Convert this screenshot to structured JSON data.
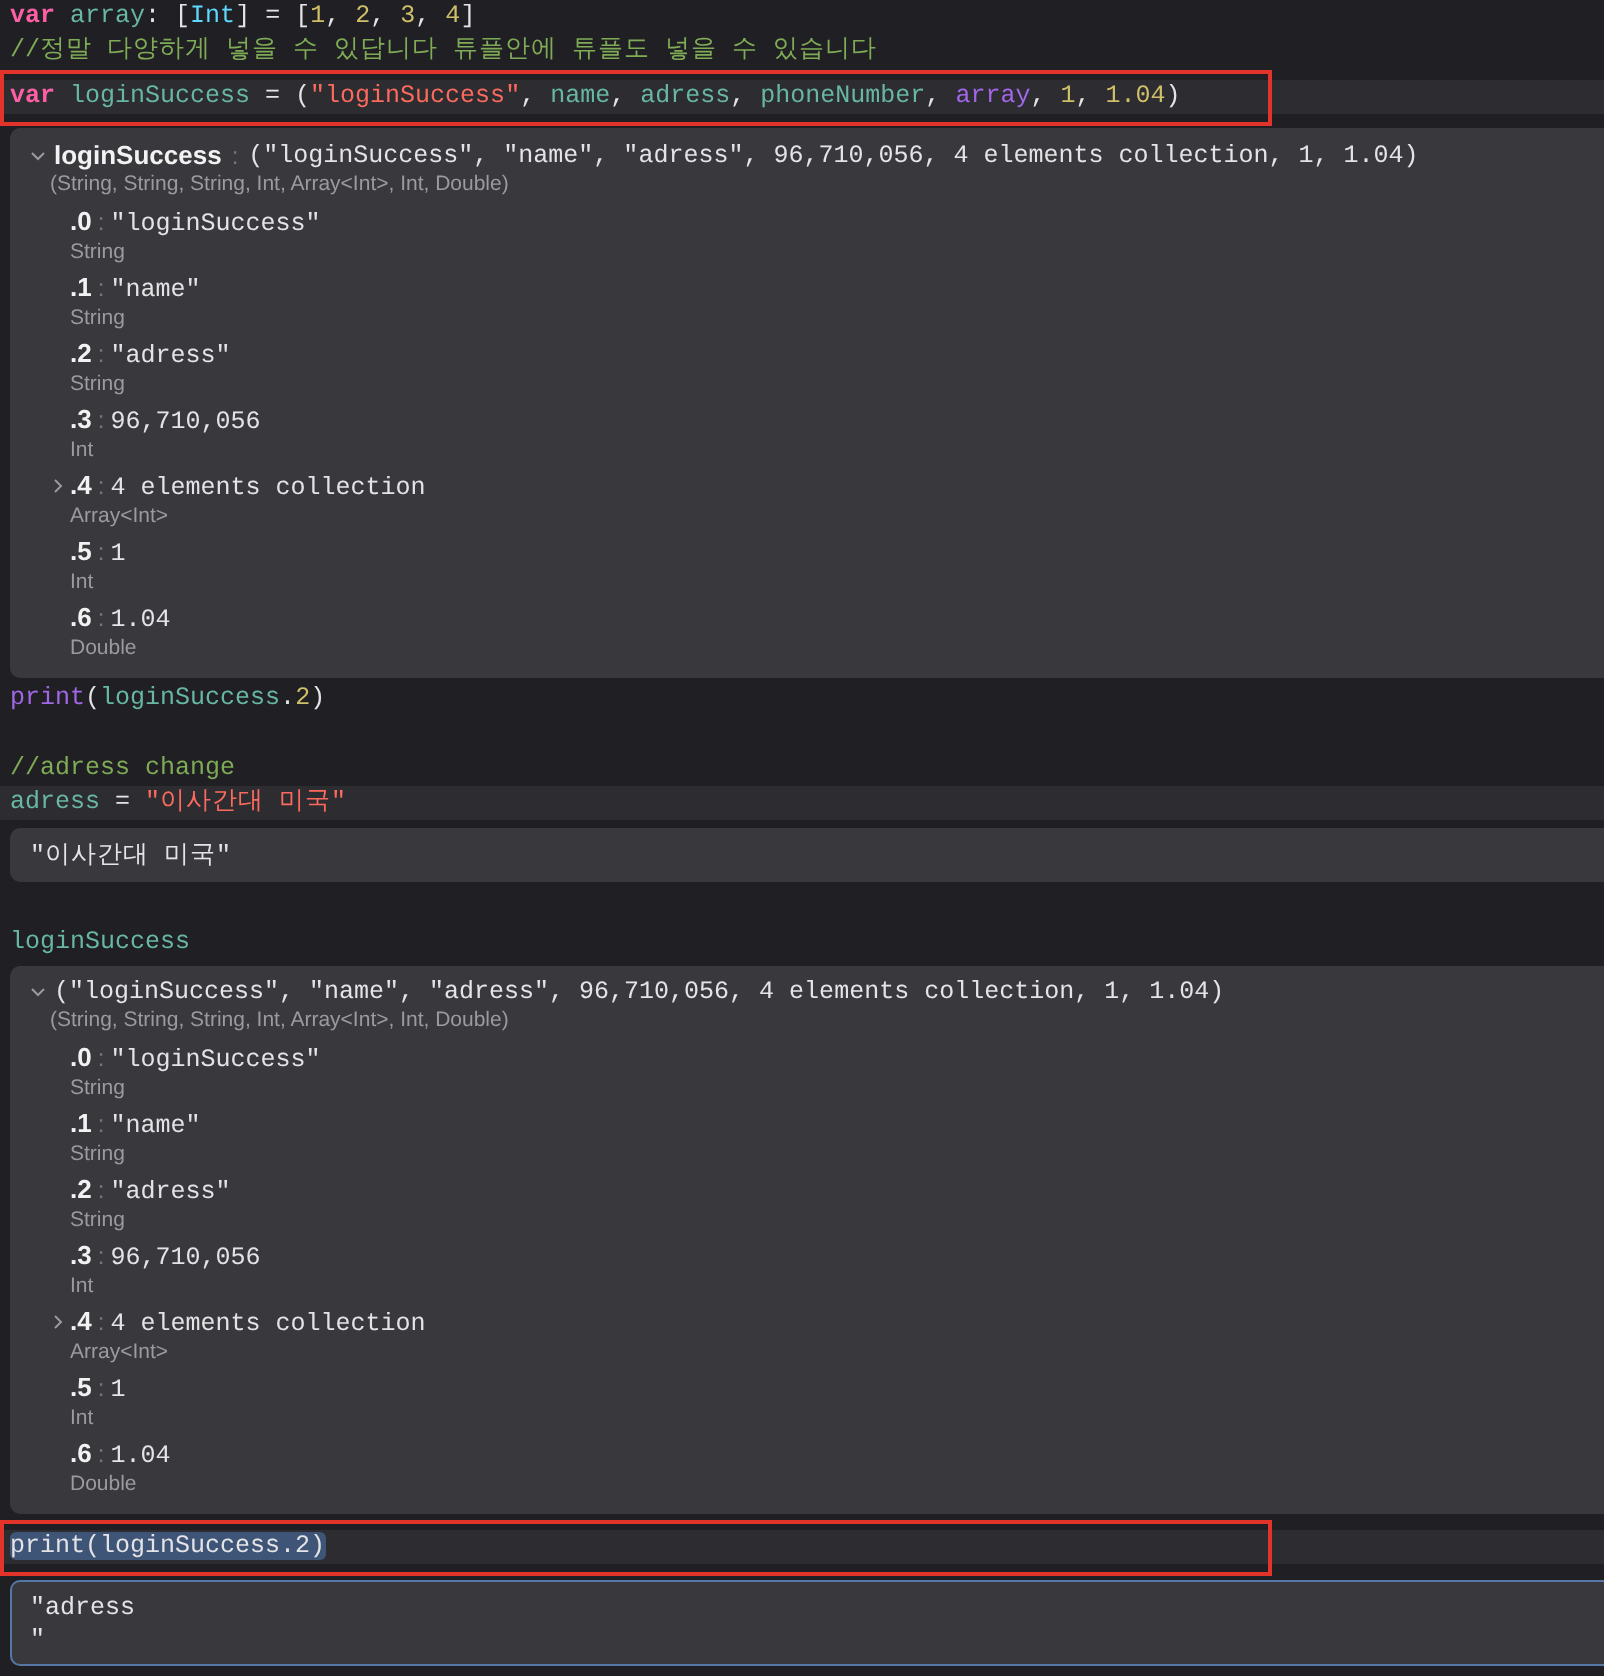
{
  "editor": [
    {
      "kind": "code",
      "current": false,
      "boxed": false,
      "selected": false,
      "tokens": [
        {
          "text": "var ",
          "kind": "keyword"
        },
        {
          "text": "array",
          "kind": "ident"
        },
        {
          "text": ": [",
          "kind": "plain"
        },
        {
          "text": "Int",
          "kind": "type"
        },
        {
          "text": "] = [",
          "kind": "plain"
        },
        {
          "text": "1",
          "kind": "number"
        },
        {
          "text": ", ",
          "kind": "plain"
        },
        {
          "text": "2",
          "kind": "number"
        },
        {
          "text": ", ",
          "kind": "plain"
        },
        {
          "text": "3",
          "kind": "number"
        },
        {
          "text": ", ",
          "kind": "plain"
        },
        {
          "text": "4",
          "kind": "number"
        },
        {
          "text": "]",
          "kind": "plain"
        }
      ]
    },
    {
      "kind": "code",
      "current": false,
      "boxed": false,
      "selected": false,
      "tokens": [
        {
          "text": "//정말 다양하게 넣을 수 있답니다 튜플안에 튜플도 넣을 수 있습니다",
          "kind": "comment"
        }
      ]
    },
    {
      "kind": "code",
      "current": true,
      "boxed": true,
      "selected": false,
      "tokens": [
        {
          "text": "var ",
          "kind": "keyword"
        },
        {
          "text": "loginSuccess",
          "kind": "ident"
        },
        {
          "text": " = (",
          "kind": "plain"
        },
        {
          "text": "\"loginSuccess\"",
          "kind": "string"
        },
        {
          "text": ", ",
          "kind": "plain"
        },
        {
          "text": "name",
          "kind": "ident"
        },
        {
          "text": ", ",
          "kind": "plain"
        },
        {
          "text": "adress",
          "kind": "ident"
        },
        {
          "text": ", ",
          "kind": "plain"
        },
        {
          "text": "phoneNumber",
          "kind": "ident"
        },
        {
          "text": ", ",
          "kind": "plain"
        },
        {
          "text": "array",
          "kind": "project"
        },
        {
          "text": ", ",
          "kind": "plain"
        },
        {
          "text": "1",
          "kind": "number"
        },
        {
          "text": ", ",
          "kind": "plain"
        },
        {
          "text": "1.04",
          "kind": "number"
        },
        {
          "text": ")",
          "kind": "plain"
        }
      ]
    },
    {
      "kind": "result",
      "focused": false,
      "expanded": true,
      "name": "loginSuccess",
      "sep": ":",
      "value": "(\"loginSuccess\", \"name\", \"adress\", 96,710,056, 4 elements collection, 1, 1.04)",
      "type": "(String, String, String, Int, Array<Int>, Int, Double)",
      "items": [
        {
          "index": ".0",
          "sep": ":",
          "value": "\"loginSuccess\"",
          "type": "String"
        },
        {
          "index": ".1",
          "sep": ":",
          "value": "\"name\"",
          "type": "String"
        },
        {
          "index": ".2",
          "sep": ":",
          "value": "\"adress\"",
          "type": "String"
        },
        {
          "index": ".3",
          "sep": ":",
          "value": "96,710,056",
          "type": "Int"
        },
        {
          "index": ".4",
          "sep": ":",
          "value": "4 elements collection",
          "type": "Array<Int>",
          "expanded": false
        },
        {
          "index": ".5",
          "sep": ":",
          "value": "1",
          "type": "Int"
        },
        {
          "index": ".6",
          "sep": ":",
          "value": "1.04",
          "type": "Double"
        }
      ]
    },
    {
      "kind": "code",
      "current": false,
      "boxed": false,
      "selected": false,
      "tokens": [
        {
          "text": "print",
          "kind": "function"
        },
        {
          "text": "(",
          "kind": "plain"
        },
        {
          "text": "loginSuccess",
          "kind": "ident"
        },
        {
          "text": ".",
          "kind": "plain"
        },
        {
          "text": "2",
          "kind": "number"
        },
        {
          "text": ")",
          "kind": "plain"
        }
      ]
    },
    {
      "kind": "blank"
    },
    {
      "kind": "code",
      "current": false,
      "boxed": false,
      "selected": false,
      "tokens": [
        {
          "text": "//adress change",
          "kind": "comment"
        }
      ]
    },
    {
      "kind": "code",
      "current": true,
      "boxed": false,
      "selected": false,
      "tokens": [
        {
          "text": "adress",
          "kind": "ident"
        },
        {
          "text": " = ",
          "kind": "plain"
        },
        {
          "text": "\"이사간대 미국\"",
          "kind": "string"
        }
      ]
    },
    {
      "kind": "result",
      "focused": false,
      "value": "\"이사간대 미국\""
    },
    {
      "kind": "blank"
    },
    {
      "kind": "code",
      "current": false,
      "boxed": false,
      "selected": false,
      "tokens": [
        {
          "text": "loginSuccess",
          "kind": "ident"
        }
      ]
    },
    {
      "kind": "result",
      "focused": false,
      "expanded": true,
      "value": "(\"loginSuccess\", \"name\", \"adress\", 96,710,056, 4 elements collection, 1, 1.04)",
      "type": "(String, String, String, Int, Array<Int>, Int, Double)",
      "items": [
        {
          "index": ".0",
          "sep": ":",
          "value": "\"loginSuccess\"",
          "type": "String"
        },
        {
          "index": ".1",
          "sep": ":",
          "value": "\"name\"",
          "type": "String"
        },
        {
          "index": ".2",
          "sep": ":",
          "value": "\"adress\"",
          "type": "String"
        },
        {
          "index": ".3",
          "sep": ":",
          "value": "96,710,056",
          "type": "Int"
        },
        {
          "index": ".4",
          "sep": ":",
          "value": "4 elements collection",
          "type": "Array<Int>",
          "expanded": false
        },
        {
          "index": ".5",
          "sep": ":",
          "value": "1",
          "type": "Int"
        },
        {
          "index": ".6",
          "sep": ":",
          "value": "1.04",
          "type": "Double"
        }
      ]
    },
    {
      "kind": "code",
      "current": true,
      "boxed": true,
      "selected": true,
      "tokens": [
        {
          "text": "print(loginSuccess.2)",
          "kind": "plain"
        }
      ]
    },
    {
      "kind": "result",
      "focused": true,
      "value": "\"adress\n\""
    }
  ]
}
